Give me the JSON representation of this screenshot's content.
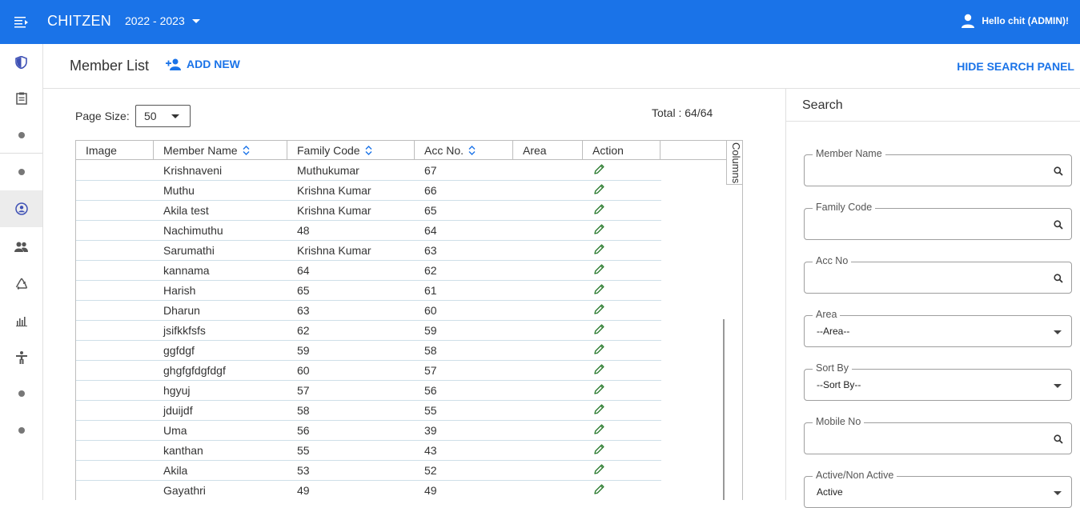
{
  "app": {
    "title": "CHITZEN",
    "year": "2022 - 2023",
    "user_greeting": "Hello chit (ADMIN)!"
  },
  "sidebar": {
    "items": [
      {
        "icon": "shield-icon"
      },
      {
        "icon": "clipboard-icon"
      },
      {
        "icon": "dot-icon"
      },
      {
        "icon": "dot-icon"
      },
      {
        "icon": "user-circle-icon",
        "active": true
      },
      {
        "icon": "people-icon"
      },
      {
        "icon": "recycle-icon"
      },
      {
        "icon": "bar-chart-icon"
      },
      {
        "icon": "accessibility-icon"
      },
      {
        "icon": "dot-icon"
      },
      {
        "icon": "dot-icon"
      }
    ]
  },
  "header": {
    "title": "Member List",
    "add_new": "ADD NEW",
    "hide_search": "HIDE SEARCH PANEL"
  },
  "list": {
    "page_size_label": "Page Size:",
    "page_size": "50",
    "total": "Total : 64/64",
    "columns_label": "Columns",
    "columns": [
      "Image",
      "Member Name",
      "Family Code",
      "Acc No.",
      "Area",
      "Action"
    ],
    "rows": [
      {
        "name": "Krishnaveni",
        "family": "Muthukumar",
        "acc": "67",
        "area": ""
      },
      {
        "name": "Muthu",
        "family": "Krishna Kumar",
        "acc": "66",
        "area": ""
      },
      {
        "name": "Akila test",
        "family": "Krishna Kumar",
        "acc": "65",
        "area": ""
      },
      {
        "name": "Nachimuthu",
        "family": "48",
        "acc": "64",
        "area": ""
      },
      {
        "name": "Sarumathi",
        "family": "Krishna Kumar",
        "acc": "63",
        "area": ""
      },
      {
        "name": "kannama",
        "family": "64",
        "acc": "62",
        "area": ""
      },
      {
        "name": "Harish",
        "family": "65",
        "acc": "61",
        "area": ""
      },
      {
        "name": "Dharun",
        "family": "63",
        "acc": "60",
        "area": ""
      },
      {
        "name": "jsifkkfsfs",
        "family": "62",
        "acc": "59",
        "area": ""
      },
      {
        "name": "ggfdgf",
        "family": "59",
        "acc": "58",
        "area": ""
      },
      {
        "name": "ghgfgfdgfdgf",
        "family": "60",
        "acc": "57",
        "area": ""
      },
      {
        "name": "hgyuj",
        "family": "57",
        "acc": "56",
        "area": ""
      },
      {
        "name": "jduijdf",
        "family": "58",
        "acc": "55",
        "area": ""
      },
      {
        "name": "Uma",
        "family": "56",
        "acc": "39",
        "area": ""
      },
      {
        "name": "kanthan",
        "family": "55",
        "acc": "43",
        "area": ""
      },
      {
        "name": "Akila",
        "family": "53",
        "acc": "52",
        "area": ""
      },
      {
        "name": "Gayathri",
        "family": "49",
        "acc": "49",
        "area": ""
      }
    ]
  },
  "search": {
    "title": "Search",
    "fields": [
      {
        "label": "Member Name",
        "value": "",
        "type": "text"
      },
      {
        "label": "Family Code",
        "value": "",
        "type": "text"
      },
      {
        "label": "Acc No",
        "value": "",
        "type": "text"
      },
      {
        "label": "Area",
        "value": "--Area--",
        "type": "select"
      },
      {
        "label": "Sort By",
        "value": "--Sort By--",
        "type": "select"
      },
      {
        "label": "Mobile No",
        "value": "",
        "type": "text"
      },
      {
        "label": "Active/Non Active",
        "value": "Active",
        "type": "select"
      }
    ]
  },
  "colors": {
    "primary": "#1a73e8",
    "edit_icon": "#2e7d32",
    "sort_icon": "#1a73e8"
  }
}
